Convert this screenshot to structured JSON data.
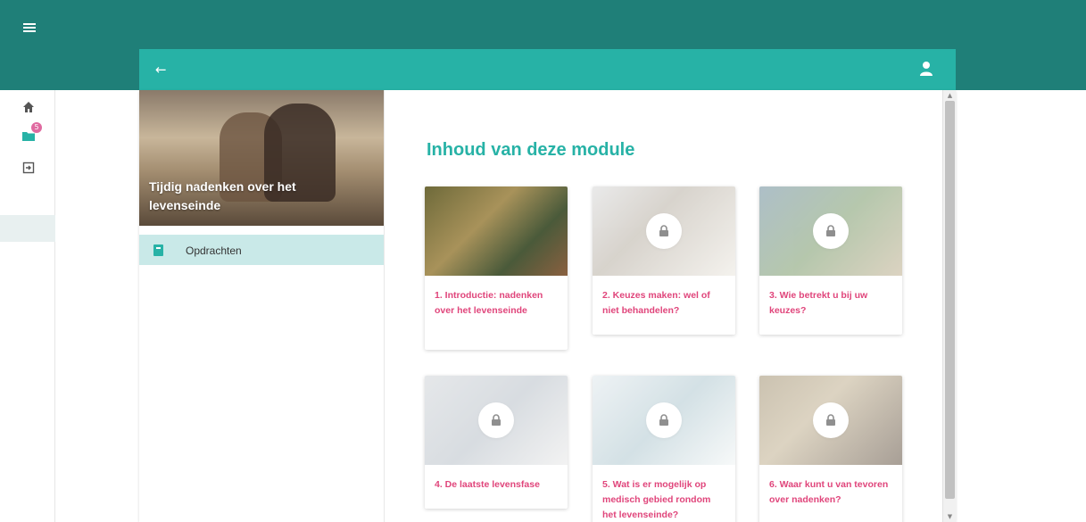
{
  "app": {
    "back_label": "←"
  },
  "sidenav": {
    "badge_count": "5",
    "items": [
      "home",
      "modules",
      "logout"
    ]
  },
  "module": {
    "hero_title": "Tijdig nadenken over het levenseinde",
    "menu_item": "Opdrachten"
  },
  "content": {
    "title": "Inhoud van deze module",
    "cards": [
      {
        "label": "1. Introductie: nadenken over het levenseinde",
        "locked": false
      },
      {
        "label": "2. Keuzes maken: wel of niet behandelen?",
        "locked": true
      },
      {
        "label": "3. Wie betrekt u bij uw keuzes?",
        "locked": true
      },
      {
        "label": "4. De laatste levensfase",
        "locked": true
      },
      {
        "label": "5. Wat is er mogelijk op medisch gebied rondom het levenseinde?",
        "locked": true
      },
      {
        "label": "6. Waar kunt u van tevoren over nadenken?",
        "locked": true
      }
    ]
  },
  "colors": {
    "topbar": "#1f7f78",
    "accent": "#27b2a6",
    "card_title": "#e0457b",
    "active_menu": "#c9e9e8"
  }
}
